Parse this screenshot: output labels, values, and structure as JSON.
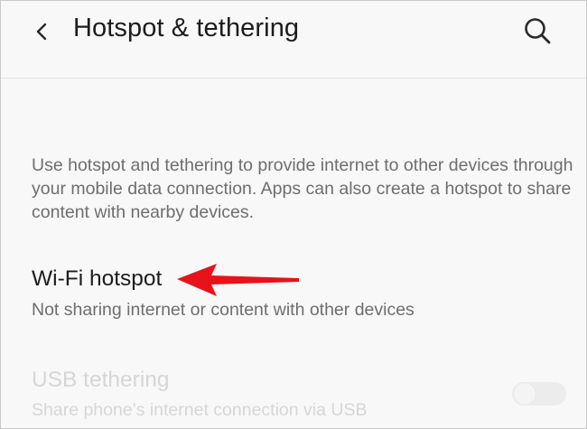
{
  "header": {
    "title": "Hotspot & tethering",
    "back_icon": "back-arrow-icon",
    "search_icon": "search-icon"
  },
  "description": "Use hotspot and tethering to provide internet to other devices through your mobile data connection. Apps can also create a hotspot to share content with nearby devices.",
  "items": [
    {
      "title": "Wi-Fi hotspot",
      "subtitle": "Not sharing internet or content with other devices",
      "enabled": true
    },
    {
      "title": "USB tethering",
      "subtitle": "Share phone’s internet connection via USB",
      "enabled": false,
      "toggle_on": false
    }
  ],
  "annotation": {
    "arrow_icon": "pointer-arrow-icon",
    "arrow_color": "#e8121a"
  },
  "colors": {
    "background": "#f8f8f8",
    "title_text": "#1c1c1c",
    "secondary_text": "#6e6e6e",
    "disabled_text": "#d6d6d6"
  }
}
